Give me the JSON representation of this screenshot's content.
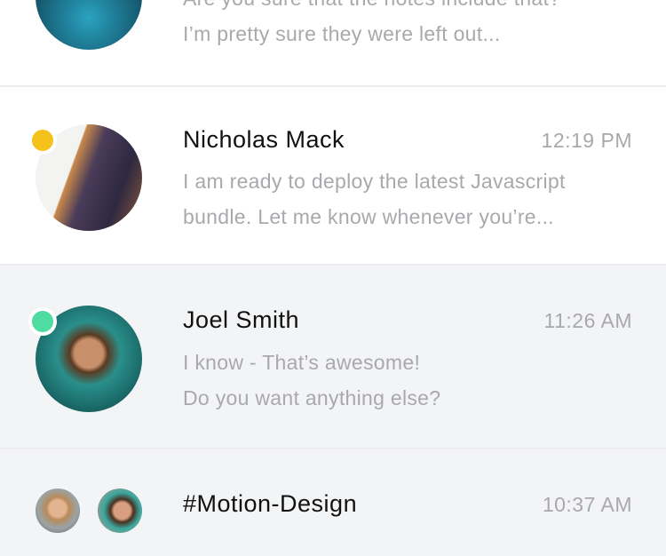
{
  "conversations": [
    {
      "name": "",
      "time": "",
      "lines": [
        "Are you sure that the notes include that?",
        "I’m pretty sure they were left out..."
      ]
    },
    {
      "name": "Nicholas Mack",
      "time": "12:19 PM",
      "lines": [
        "I am ready to deploy the latest Javascript",
        "bundle. Let me know whenever you’re..."
      ],
      "status_color": "#f4c21b"
    },
    {
      "name": "Joel Smith",
      "time": "11:26 AM",
      "lines": [
        "I know - That’s awesome!",
        "Do you want anything else?"
      ],
      "status_color": "#4fdca0"
    },
    {
      "name": "#Motion-Design",
      "time": "10:37 AM"
    }
  ]
}
